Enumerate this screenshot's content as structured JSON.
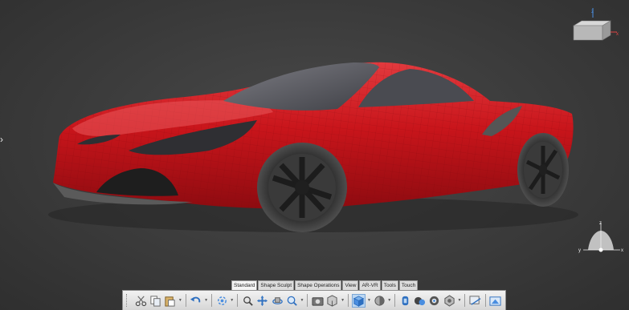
{
  "colors": {
    "background": "#3b3b3b",
    "car_body": "#c9151b",
    "toolbar_bg": "#e6e6e6"
  },
  "ribbon": {
    "tabs": [
      {
        "label": "Standard",
        "active": true
      },
      {
        "label": "Shape Sculpt",
        "active": false
      },
      {
        "label": "Shape Operations",
        "active": false
      },
      {
        "label": "View",
        "active": false
      },
      {
        "label": "AR-VR",
        "active": false
      },
      {
        "label": "Tools",
        "active": false
      },
      {
        "label": "Touch",
        "active": false
      }
    ]
  },
  "toolbar": {
    "buttons": [
      {
        "name": "cut-icon"
      },
      {
        "name": "copy-icon"
      },
      {
        "name": "paste-icon"
      },
      {
        "name": "undo-icon"
      },
      {
        "name": "update-icon"
      },
      {
        "name": "fly-mode-icon"
      },
      {
        "name": "pan-icon"
      },
      {
        "name": "rotate-icon"
      },
      {
        "name": "zoom-icon"
      },
      {
        "name": "capture-icon"
      },
      {
        "name": "normal-view-icon"
      },
      {
        "name": "iso-view-icon"
      },
      {
        "name": "shading-icon"
      },
      {
        "name": "hide-show-icon"
      },
      {
        "name": "swap-visible-space-icon"
      },
      {
        "name": "materials-icon"
      },
      {
        "name": "render-icon"
      },
      {
        "name": "measure-icon"
      },
      {
        "name": "analysis-icon"
      }
    ]
  },
  "compass": {
    "cube_axes": [
      "z",
      "x"
    ],
    "triad_axes": [
      "z",
      "y",
      "x"
    ]
  }
}
